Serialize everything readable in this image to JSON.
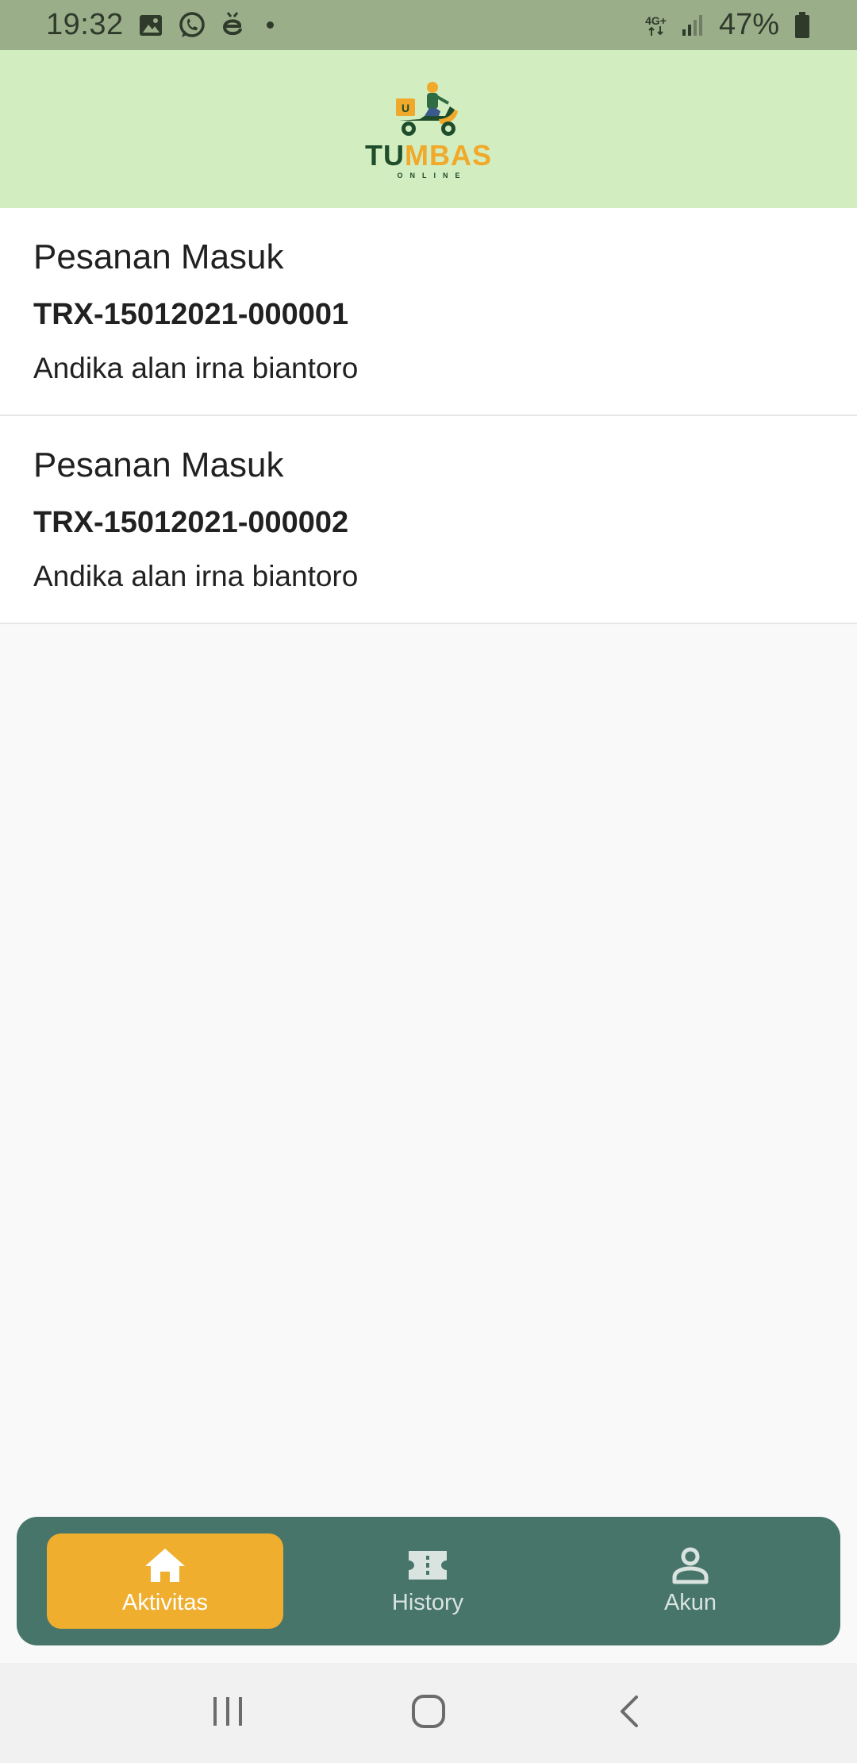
{
  "status_bar": {
    "time": "19:32",
    "network_type": "4G+",
    "battery_percent": "47%",
    "notification_icons": [
      "image-icon",
      "whatsapp-icon",
      "e-app-icon",
      "dot-icon"
    ],
    "system_icons": [
      "network-4g-icon",
      "signal-icon",
      "battery-icon"
    ]
  },
  "app_bar": {
    "logo": {
      "text_part1": "TU",
      "text_part2": "MBAS",
      "subtitle": "ONLINE",
      "colors": {
        "dark": "#1f4d2c",
        "accent": "#f0a92a"
      }
    }
  },
  "orders": [
    {
      "status": "Pesanan Masuk",
      "code": "TRX-15012021-000001",
      "customer": "Andika alan irna biantoro"
    },
    {
      "status": "Pesanan Masuk",
      "code": "TRX-15012021-000002",
      "customer": "Andika alan irna biantoro"
    }
  ],
  "bottom_nav": {
    "items": [
      {
        "label": "Aktivitas",
        "icon": "home-icon",
        "active": true
      },
      {
        "label": "History",
        "icon": "ticket-icon",
        "active": false
      },
      {
        "label": "Akun",
        "icon": "person-icon",
        "active": false
      }
    ],
    "colors": {
      "background": "#47756a",
      "active": "#f0ae2e"
    }
  },
  "system_nav": {
    "buttons": [
      "recents-icon",
      "home-circle-icon",
      "back-icon"
    ]
  }
}
